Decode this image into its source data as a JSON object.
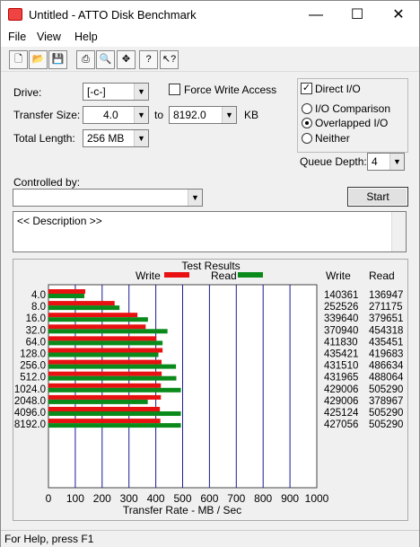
{
  "window": {
    "title": "Untitled - ATTO Disk Benchmark"
  },
  "menu": [
    "File",
    "View",
    "Help"
  ],
  "toolbar": [
    "new-icon",
    "open-icon",
    "save-icon",
    "print-icon",
    "print-preview-icon",
    "move-icon",
    "help-icon",
    "context-help-icon"
  ],
  "form": {
    "drive_label": "Drive:",
    "drive_value": "[-c-]",
    "force_write_label": "Force Write Access",
    "force_write_checked": false,
    "direct_io_label": "Direct I/O",
    "direct_io_checked": true,
    "transfer_size_label": "Transfer Size:",
    "transfer_from": "4.0",
    "to_label": "to",
    "transfer_to": "8192.0",
    "kb_label": "KB",
    "total_length_label": "Total Length:",
    "total_length_value": "256 MB",
    "io_options": [
      "I/O Comparison",
      "Overlapped I/O",
      "Neither"
    ],
    "io_selected": "Overlapped I/O",
    "queue_depth_label": "Queue Depth:",
    "queue_depth_value": "4",
    "controlled_by_label": "Controlled by:",
    "controlled_by_value": "",
    "start_label": "Start",
    "description": "<< Description >>"
  },
  "results": {
    "group_title": "Test Results",
    "write_legend": "Write",
    "read_legend": "Read",
    "write_header": "Write",
    "read_header": "Read"
  },
  "chart_data": {
    "type": "bar",
    "categories": [
      "4.0",
      "8.0",
      "16.0",
      "32.0",
      "64.0",
      "128.0",
      "256.0",
      "512.0",
      "1024.0",
      "2048.0",
      "4096.0",
      "8192.0"
    ],
    "series": [
      {
        "name": "Write",
        "values": [
          140361,
          252526,
          339640,
          370940,
          411830,
          435421,
          431510,
          431965,
          429006,
          429006,
          425124,
          427056
        ],
        "color": "#e81010"
      },
      {
        "name": "Read",
        "values": [
          136947,
          271175,
          379651,
          454318,
          435451,
          419683,
          486634,
          488064,
          505290,
          378967,
          505290,
          505290
        ],
        "color": "#0a8a1a"
      }
    ],
    "xlabel": "Transfer Rate - MB / Sec",
    "xlim": [
      0,
      1000
    ],
    "xticks": [
      "0",
      "100",
      "200",
      "300",
      "400",
      "500",
      "600",
      "700",
      "800",
      "900",
      "1000"
    ]
  },
  "status": "For Help, press F1"
}
